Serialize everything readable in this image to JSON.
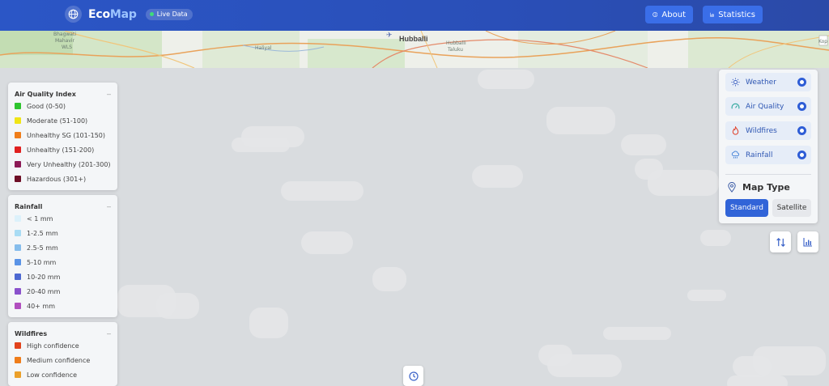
{
  "header": {
    "brand_eco": "Eco",
    "brand_map": "Map",
    "live_badge": "Live Data",
    "about_label": "About",
    "statistics_label": "Statistics"
  },
  "map_strip": {
    "city": "Hubballi",
    "labels": [
      "Bhagwati",
      "Mahavir",
      "WLS",
      "Haliyal",
      "Hubballi",
      "Taluku",
      "Kop"
    ]
  },
  "legends": {
    "air_quality": {
      "title": "Air Quality Index",
      "items": [
        {
          "label": "Good (0-50)",
          "color": "#2ec42e"
        },
        {
          "label": "Moderate (51-100)",
          "color": "#f0e516"
        },
        {
          "label": "Unhealthy SG (101-150)",
          "color": "#ef7d1a"
        },
        {
          "label": "Unhealthy (151-200)",
          "color": "#e0201f"
        },
        {
          "label": "Very Unhealthy (201-300)",
          "color": "#8c1a56"
        },
        {
          "label": "Hazardous (301+)",
          "color": "#6e0f26"
        }
      ]
    },
    "rainfall": {
      "title": "Rainfall",
      "items": [
        {
          "label": "< 1 mm",
          "color": "#dcf1fb"
        },
        {
          "label": "1-2.5 mm",
          "color": "#a9dcf4"
        },
        {
          "label": "2.5-5 mm",
          "color": "#86bdec"
        },
        {
          "label": "5-10 mm",
          "color": "#5a93e6"
        },
        {
          "label": "10-20 mm",
          "color": "#4d68d1"
        },
        {
          "label": "20-40 mm",
          "color": "#8a51cc"
        },
        {
          "label": "40+ mm",
          "color": "#b14fbf"
        }
      ]
    },
    "wildfires": {
      "title": "Wildfires",
      "items": [
        {
          "label": "High confidence",
          "color": "#e2431c"
        },
        {
          "label": "Medium confidence",
          "color": "#ef7d1a"
        },
        {
          "label": "Low confidence",
          "color": "#eba02a"
        }
      ]
    }
  },
  "layers": {
    "items": [
      {
        "label": "Weather",
        "icon": "sun-icon"
      },
      {
        "label": "Air Quality",
        "icon": "gauge-icon"
      },
      {
        "label": "Wildfires",
        "icon": "flame-icon"
      },
      {
        "label": "Rainfall",
        "icon": "rain-cloud-icon"
      }
    ],
    "map_type_label": "Map Type",
    "standard_label": "Standard",
    "satellite_label": "Satellite"
  },
  "colors": {
    "header": "#2b52bf",
    "accent": "#3164d8",
    "layer_text": "#2f57b3"
  }
}
